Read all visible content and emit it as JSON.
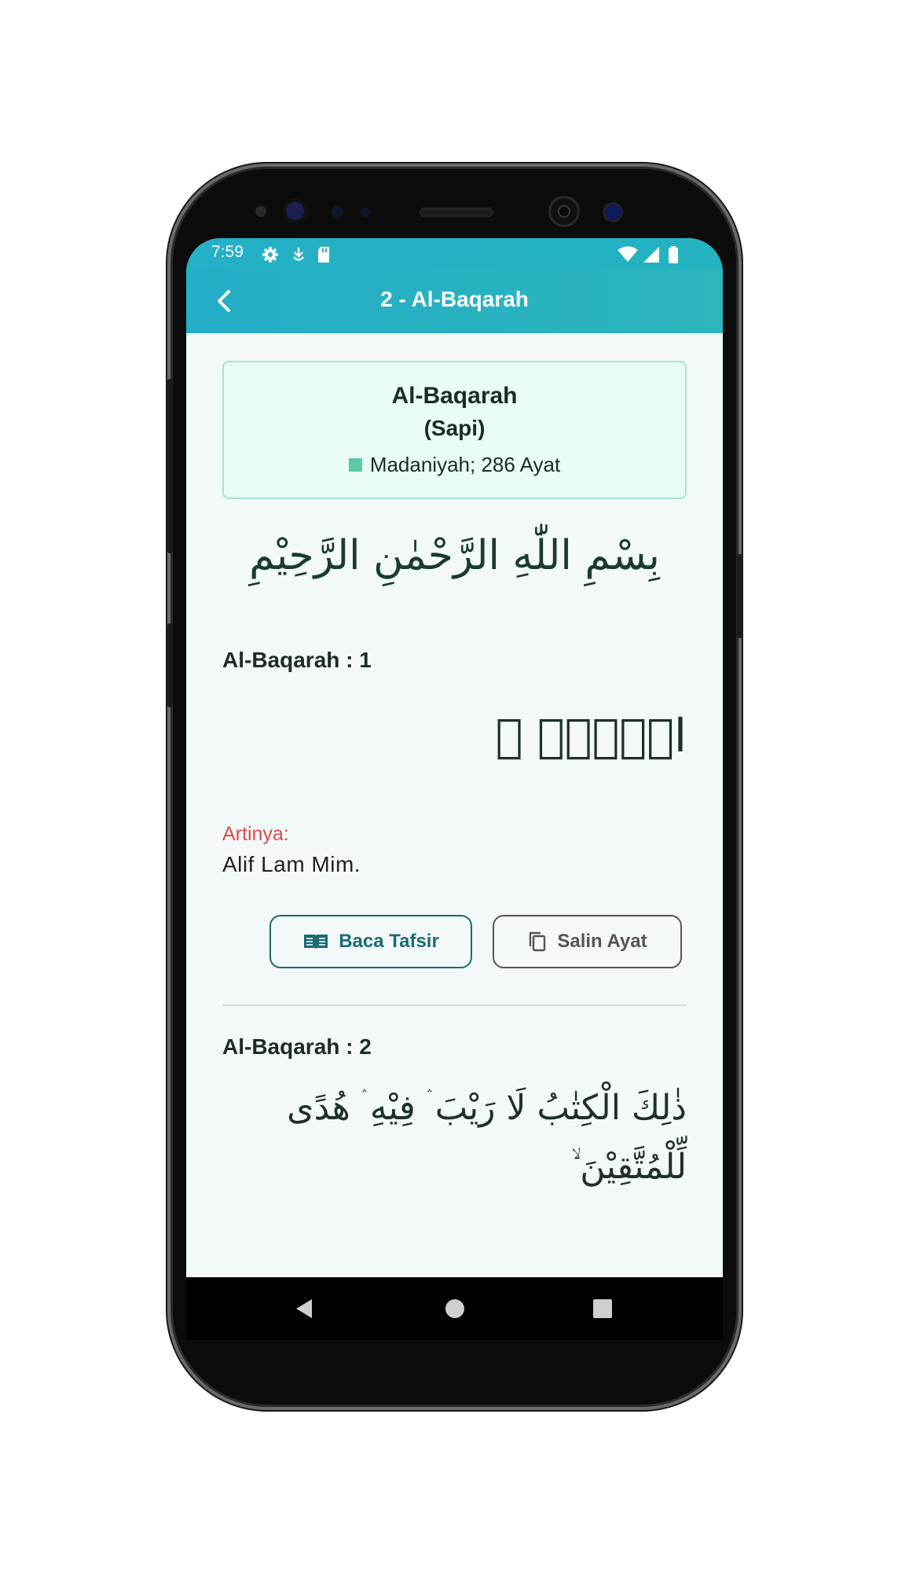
{
  "status_bar": {
    "time": "7:59",
    "left_icons": [
      "gear-icon",
      "download-icon",
      "sd-card-icon"
    ],
    "right_icons": [
      "wifi-icon",
      "signal-icon",
      "battery-icon"
    ]
  },
  "app_bar": {
    "title": "2 - Al-Baqarah",
    "back_icon": "chevron-left-icon"
  },
  "surah_info": {
    "name": "Al-Baqarah",
    "meaning": "(Sapi)",
    "meta": "Madaniyah; 286 Ayat",
    "accent": "#5ccaa6"
  },
  "bismillah": "بِسْمِ اللّٰهِ الرَّحْمٰنِ الرَّحِيْمِ",
  "ayahs": [
    {
      "header": "Al-Baqarah : 1",
      "arabic": "الۤمّۤ ۚ",
      "translation_label": "Artinya:",
      "translation": "Alif Lam Mim.",
      "tafsir_button": "Baca Tafsir",
      "copy_button": "Salin Ayat"
    },
    {
      "header": "Al-Baqarah : 2",
      "arabic_line1": "ذٰلِكَ الْكِتٰبُ لَا رَيْبَ ۛ فِيْهِ ۛ هُدًى",
      "arabic_line2": "لِّلْمُتَّقِيْنَ ۙ"
    }
  ],
  "nav_bar": {
    "back_icon": "triangle-back-icon",
    "home_icon": "circle-home-icon",
    "recents_icon": "square-recents-icon"
  },
  "colors": {
    "app_bar": "#24aec7",
    "card_bg": "#e9fbf6",
    "card_border": "#a6e4d3",
    "label_red": "#e04b4b",
    "primary_button": "#1a6b74"
  }
}
